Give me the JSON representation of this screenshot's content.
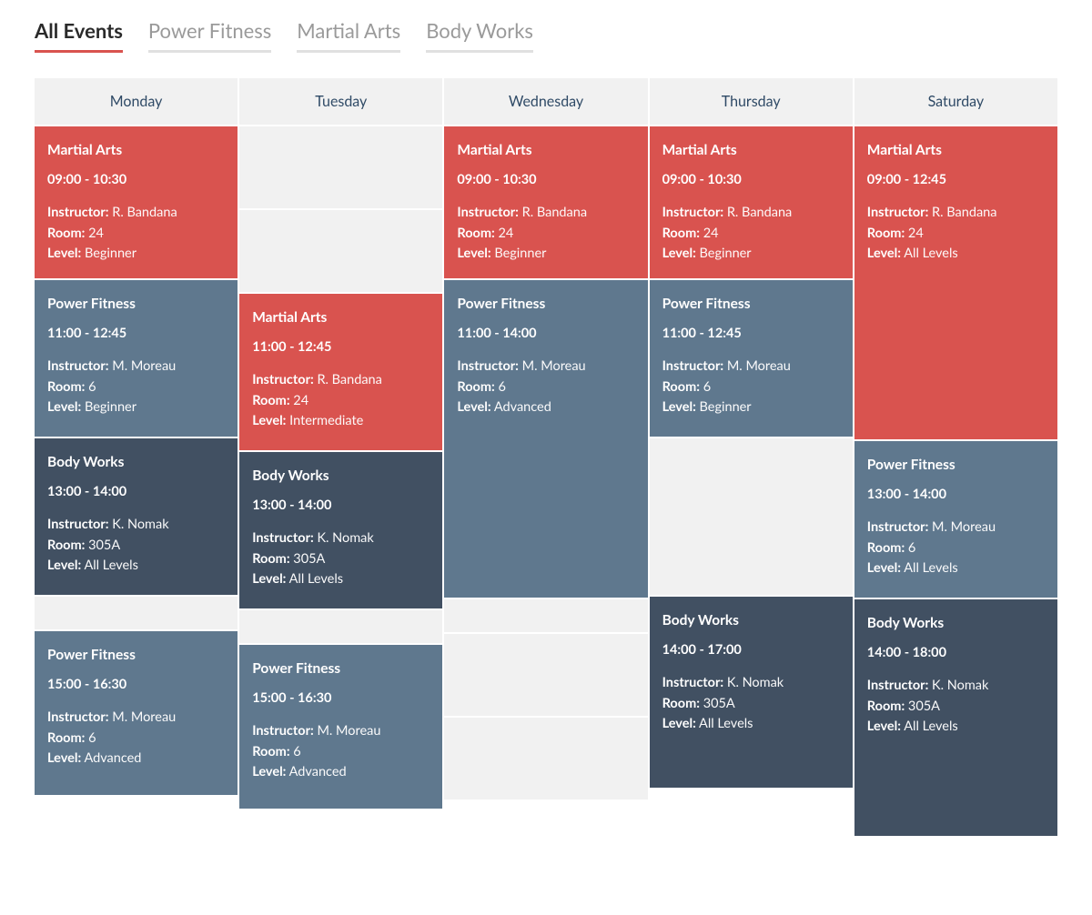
{
  "tabs": [
    {
      "label": "All Events",
      "active": true
    },
    {
      "label": "Power Fitness",
      "active": false
    },
    {
      "label": "Martial Arts",
      "active": false
    },
    {
      "label": "Body Works",
      "active": false
    }
  ],
  "field_labels": {
    "instructor": "Instructor:",
    "room": "Room:",
    "level": "Level:"
  },
  "days": [
    "Monday",
    "Tuesday",
    "Wednesday",
    "Thursday",
    "Saturday"
  ],
  "columns": [
    [
      {
        "type": "martial",
        "title": "Martial Arts",
        "time": "09:00 - 10:30",
        "instructor": "R. Bandana",
        "room": "24",
        "level": "Beginner",
        "h": "h167"
      },
      {
        "type": "power",
        "title": "Power Fitness",
        "time": "11:00 - 12:45",
        "instructor": "M. Moreau",
        "room": "6",
        "level": "Beginner",
        "h": "h172"
      },
      {
        "type": "body",
        "title": "Body Works",
        "time": "13:00 - 14:00",
        "instructor": "K. Nomak",
        "room": "305A",
        "level": "All Levels",
        "h": "h172"
      },
      {
        "type": "empty",
        "h": "h36"
      },
      {
        "type": "power",
        "title": "Power Fitness",
        "time": "15:00 - 16:30",
        "instructor": "M. Moreau",
        "room": "6",
        "level": "Advanced",
        "h": "h180"
      }
    ],
    [
      {
        "type": "empty",
        "h": "h90"
      },
      {
        "type": "empty",
        "h": "h90"
      },
      {
        "type": "martial",
        "title": "Martial Arts",
        "time": "11:00 - 12:45",
        "instructor": "R. Bandana",
        "room": "24",
        "level": "Intermediate",
        "h": "h172"
      },
      {
        "type": "body",
        "title": "Body Works",
        "time": "13:00 - 14:00",
        "instructor": "K. Nomak",
        "room": "305A",
        "level": "All Levels",
        "h": "h172"
      },
      {
        "type": "empty",
        "h": "h36"
      },
      {
        "type": "power",
        "title": "Power Fitness",
        "time": "15:00 - 16:30",
        "instructor": "M. Moreau",
        "room": "6",
        "level": "Advanced",
        "h": "h180"
      }
    ],
    [
      {
        "type": "martial",
        "title": "Martial Arts",
        "time": "09:00 - 10:30",
        "instructor": "R. Bandana",
        "room": "24",
        "level": "Beginner",
        "h": "h167"
      },
      {
        "type": "power",
        "title": "Power Fitness",
        "time": "11:00 - 14:00",
        "instructor": "M. Moreau",
        "room": "6",
        "level": "Advanced",
        "h": "h349"
      },
      {
        "type": "empty",
        "h": "h36"
      },
      {
        "type": "empty",
        "h": "h90"
      },
      {
        "type": "empty",
        "h": "h90"
      }
    ],
    [
      {
        "type": "martial",
        "title": "Martial Arts",
        "time": "09:00 - 10:30",
        "instructor": "R. Bandana",
        "room": "24",
        "level": "Beginner",
        "h": "h167"
      },
      {
        "type": "power",
        "title": "Power Fitness",
        "time": "11:00 - 12:45",
        "instructor": "M. Moreau",
        "room": "6",
        "level": "Beginner",
        "h": "h172"
      },
      {
        "type": "empty",
        "h": "h172"
      },
      {
        "type": "body",
        "title": "Body Works",
        "time": "14:00 - 17:00",
        "instructor": "K. Nomak",
        "room": "305A",
        "level": "All Levels",
        "h": "h210"
      }
    ],
    [
      {
        "type": "martial",
        "title": "Martial Arts",
        "time": "09:00 - 12:45",
        "instructor": "R. Bandana",
        "room": "24",
        "level": "All Levels",
        "h": "h344"
      },
      {
        "type": "power",
        "title": "Power Fitness",
        "time": "13:00 - 14:00",
        "instructor": "M. Moreau",
        "room": "6",
        "level": "All Levels",
        "h": "h172"
      },
      {
        "type": "body",
        "title": "Body Works",
        "time": "14:00 - 18:00",
        "instructor": "K. Nomak",
        "room": "305A",
        "level": "All Levels",
        "h": "h260"
      }
    ]
  ]
}
